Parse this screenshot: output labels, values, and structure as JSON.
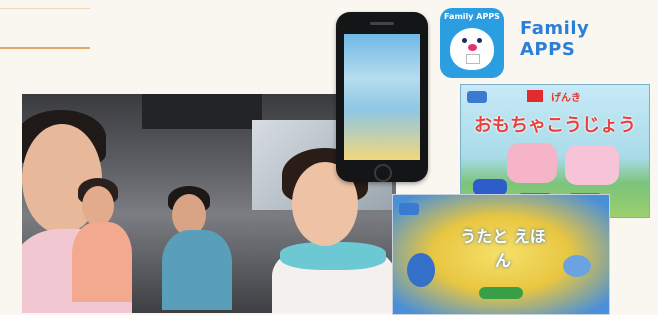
{
  "logo": {
    "text": "Family APPS"
  },
  "app_icon": {
    "label": "Family APPS"
  },
  "card1": {
    "badge_text": "",
    "subtitle": "げんき",
    "title": "おもちゃこうじょう"
  },
  "card2": {
    "title": "うたと えほん"
  },
  "colors": {
    "accent_rule": "#e4a96a",
    "brand_blue": "#2a9ee0",
    "logo_red": "#e5432a"
  }
}
